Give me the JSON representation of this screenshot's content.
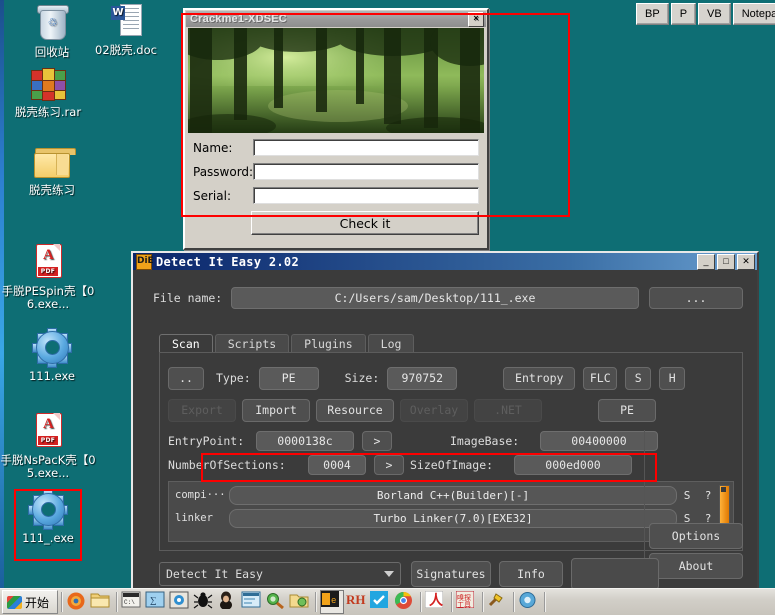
{
  "desktop": {
    "icons": [
      {
        "name": "recycle-bin",
        "label": "回收站",
        "type": "bin"
      },
      {
        "name": "doc-02",
        "label": "02脱壳.doc",
        "type": "doc"
      },
      {
        "name": "rar-archive",
        "label": "脱壳练习.rar",
        "type": "rar"
      },
      {
        "name": "folder-practice",
        "label": "脱壳练习",
        "type": "folder"
      },
      {
        "name": "pdf-pespin",
        "label": "手脱PESpin壳【06.exe...",
        "type": "pdf"
      },
      {
        "name": "exe-111",
        "label": "111.exe",
        "type": "gear"
      },
      {
        "name": "pdf-nspack",
        "label": "手脱NsPacK壳【05.exe...",
        "type": "pdf"
      },
      {
        "name": "exe-111-underscore",
        "label": "111_.exe",
        "type": "gear",
        "selected": true
      }
    ]
  },
  "top_toolbar": {
    "buttons": [
      "BP",
      "P",
      "VB",
      "Notepa"
    ]
  },
  "crackme": {
    "title": "Crackme1-XDSEC",
    "close_label": "×",
    "fields": [
      {
        "label": "Name:",
        "value": "",
        "placeholder": ""
      },
      {
        "label": "Password:",
        "value": "",
        "placeholder": ""
      },
      {
        "label": "Serial:",
        "value": "",
        "placeholder": ""
      }
    ],
    "check_button": "Check it"
  },
  "die": {
    "title": "Detect It Easy 2.02",
    "icon_text": "DiE",
    "window_controls": {
      "minimize": "_",
      "maximize": "□",
      "close": "✕"
    },
    "file_name_label": "File name:",
    "file_name_value": "C:/Users/sam/Desktop/111_.exe",
    "browse_button": "...",
    "tabs": [
      {
        "label": "Scan",
        "active": true
      },
      {
        "label": "Scripts",
        "active": false
      },
      {
        "label": "Plugins",
        "active": false
      },
      {
        "label": "Log",
        "active": false
      }
    ],
    "row1": {
      "up_button": "..",
      "type_label": "Type:",
      "type_value": "PE",
      "size_label": "Size:",
      "size_value": "970752",
      "entropy_button": "Entropy",
      "flc_button": "FLC",
      "s_button": "S",
      "h_button": "H"
    },
    "row2": {
      "export_button": "Export",
      "import_button": "Import",
      "resource_button": "Resource",
      "overlay_button": "Overlay",
      "net_button": ".NET",
      "pe_button": "PE"
    },
    "row3": {
      "entrypoint_label": "EntryPoint:",
      "entrypoint_value": "0000138c",
      "entrypoint_arrow": ">",
      "imagebase_label": "ImageBase:",
      "imagebase_value": "00400000"
    },
    "row4": {
      "sections_label": "NumberOfSections:",
      "sections_value": "0004",
      "sections_arrow": ">",
      "sizeofimage_label": "SizeOfImage:",
      "sizeofimage_value": "000ed000"
    },
    "results": [
      {
        "kind": "compi···",
        "value": "Borland C++(Builder)[-]",
        "s": "S",
        "q": "?"
      },
      {
        "kind": "linker",
        "value": "Turbo Linker(7.0)[EXE32]",
        "s": "S",
        "q": "?"
      }
    ],
    "bottom": {
      "combo_value": "Detect It Easy",
      "signatures_button": "Signatures",
      "info_button": "Info",
      "options_button": "Options",
      "about_button": "About"
    }
  },
  "taskbar": {
    "start_label": "开始"
  },
  "highlights": {
    "accent": "#fe0000"
  }
}
